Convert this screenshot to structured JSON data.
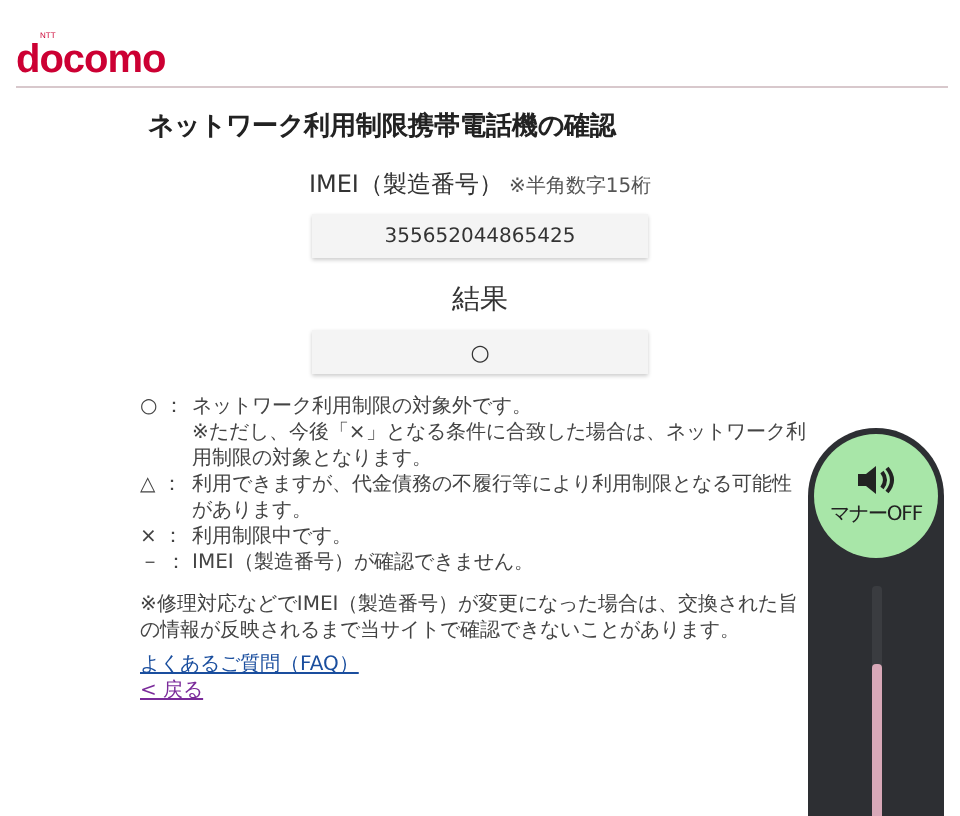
{
  "header": {
    "logo_super": "NTT",
    "logo": "docomo"
  },
  "title": "ネットワーク利用制限携帯電話機の確認",
  "imei": {
    "label": "IMEI（製造番号）",
    "hint": "※半角数字15桁",
    "value": "355652044865425"
  },
  "result": {
    "label": "結果",
    "value": "○"
  },
  "legend": [
    {
      "symbol": "○ ：",
      "text": "ネットワーク利用制限の対象外です。"
    },
    {
      "text": "※ただし、今後「×」となる条件に合致した場合は、ネットワーク利用制限の対象となります。"
    },
    {
      "symbol": "△ ：",
      "text": "利用できますが、代金債務の不履行等により利用制限となる可能性があります。"
    },
    {
      "symbol": "× ：",
      "text": "利用制限中です。"
    },
    {
      "symbol": "－ ：",
      "text": "IMEI（製造番号）が確認できません。"
    }
  ],
  "note": "※修理対応などでIMEI（製造番号）が変更になった場合は、交換された旨の情報が反映されるまで当サイトで確認できないことがあります。",
  "links": [
    {
      "label": "よくあるご質問（FAQ）",
      "visited": false
    },
    {
      "label": "< 戻る",
      "visited": true
    }
  ],
  "volume_panel": {
    "label": "マナーOFF",
    "level": 0.7
  }
}
